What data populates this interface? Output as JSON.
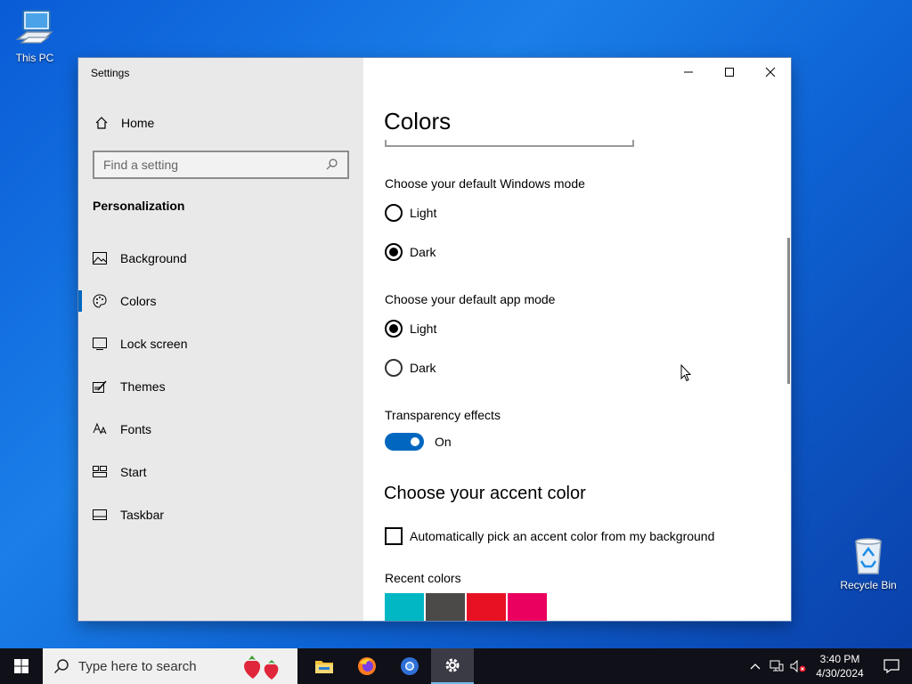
{
  "desktop": {
    "icons": [
      {
        "label": "This PC",
        "icon": "computer-icon"
      },
      {
        "label": "Recycle Bin",
        "icon": "recycle-bin-icon"
      }
    ]
  },
  "window": {
    "app_title": "Settings",
    "controls": [
      "minimize-icon",
      "maximize-icon",
      "close-icon"
    ]
  },
  "sidebar": {
    "home_label": "Home",
    "search_placeholder": "Find a setting",
    "section_title": "Personalization",
    "items": [
      {
        "label": "Background",
        "icon": "picture-icon",
        "active": false
      },
      {
        "label": "Colors",
        "icon": "palette-icon",
        "active": true
      },
      {
        "label": "Lock screen",
        "icon": "lock-screen-icon",
        "active": false
      },
      {
        "label": "Themes",
        "icon": "themes-icon",
        "active": false
      },
      {
        "label": "Fonts",
        "icon": "fonts-icon",
        "active": false
      },
      {
        "label": "Start",
        "icon": "start-icon",
        "active": false
      },
      {
        "label": "Taskbar",
        "icon": "taskbar-icon",
        "active": false
      }
    ]
  },
  "content": {
    "title": "Colors",
    "windows_mode": {
      "label": "Choose your default Windows mode",
      "options": [
        "Light",
        "Dark"
      ],
      "selected": "Dark"
    },
    "app_mode": {
      "label": "Choose your default app mode",
      "options": [
        "Light",
        "Dark"
      ],
      "selected": "Light"
    },
    "transparency": {
      "label": "Transparency effects",
      "state": "On"
    },
    "accent_heading": "Choose your accent color",
    "auto_accent_label": "Automatically pick an accent color from my background",
    "recent_colors_label": "Recent colors",
    "recent_colors": [
      "#00b7c3",
      "#4c4a48",
      "#e81123",
      "#ea005e"
    ],
    "accent_color": "#0067c0"
  },
  "taskbar": {
    "search_placeholder": "Type here to search",
    "apps": [
      "file-explorer-icon",
      "firefox-icon",
      "chromium-icon",
      "settings-icon"
    ],
    "clock_time": "3:40 PM",
    "clock_date": "4/30/2024"
  }
}
